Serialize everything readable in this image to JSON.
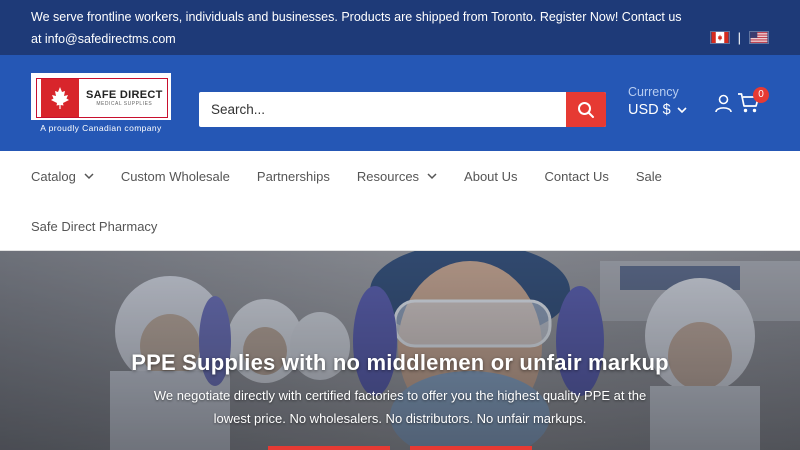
{
  "announcement": {
    "text": "We serve frontline workers, individuals and businesses. Products are shipped from Toronto. Register Now! Contact us at info@safedirectms.com"
  },
  "flags": {
    "separator": "|",
    "items": [
      "canada-flag-icon",
      "usa-flag-icon"
    ]
  },
  "logo": {
    "name": "SAFE DIRECT",
    "sub": "MEDICAL SUPPLIES",
    "tagline": "A proudly Canadian company"
  },
  "search": {
    "placeholder": "Search..."
  },
  "currency": {
    "label": "Currency",
    "value": "USD $"
  },
  "cart": {
    "count": "0"
  },
  "nav": {
    "row1": [
      {
        "label": "Catalog",
        "dropdown": true
      },
      {
        "label": "Custom Wholesale",
        "dropdown": false
      },
      {
        "label": "Partnerships",
        "dropdown": false
      },
      {
        "label": "Resources",
        "dropdown": true
      },
      {
        "label": "About Us",
        "dropdown": false
      },
      {
        "label": "Contact Us",
        "dropdown": false
      },
      {
        "label": "Sale",
        "dropdown": false
      }
    ],
    "row2": [
      {
        "label": "Safe Direct Pharmacy",
        "dropdown": false
      }
    ]
  },
  "hero": {
    "title": "PPE Supplies with no middlemen or unfair markup",
    "subtitle": "We negotiate directly with certified factories to offer you the highest quality PPE at the lowest price. No wholesalers. No distributors. No unfair markups."
  },
  "colors": {
    "announce_bg": "#1e3a78",
    "header_bg": "#2557b5",
    "accent_red": "#e63a33"
  }
}
